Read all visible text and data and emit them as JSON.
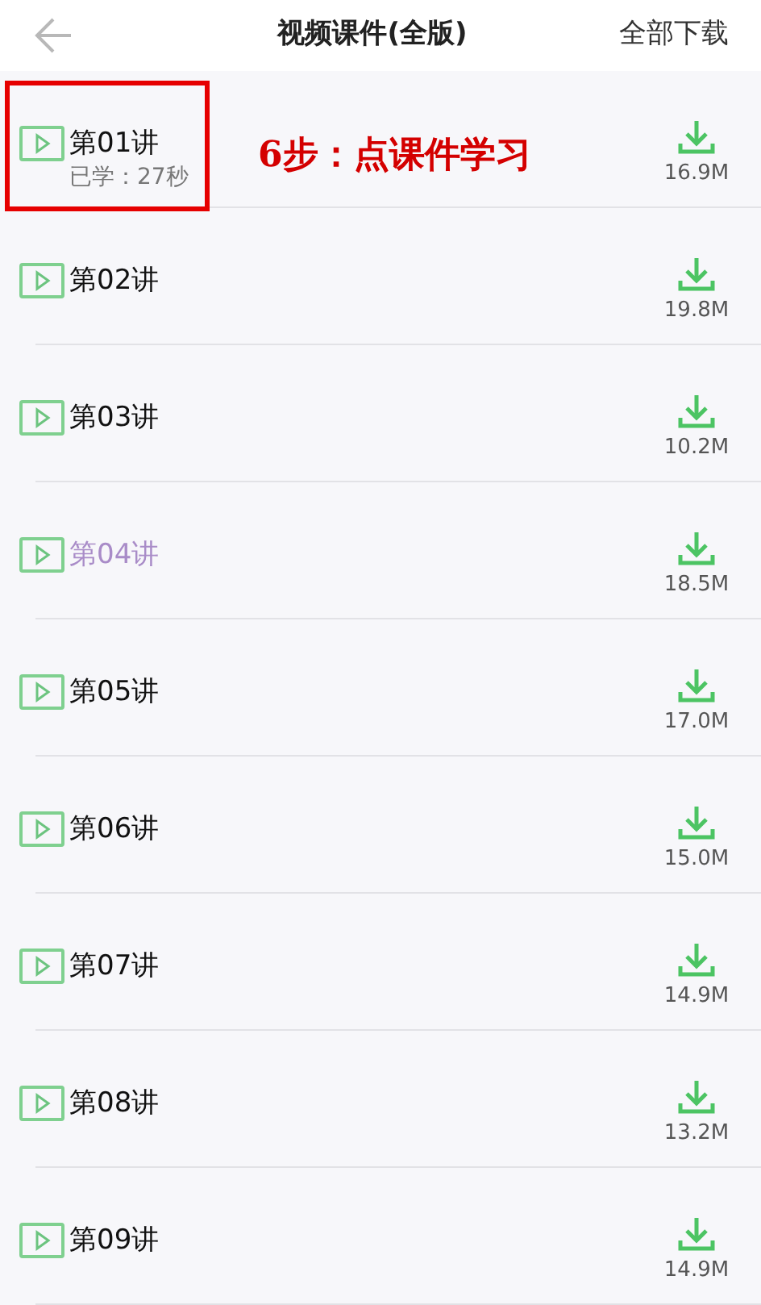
{
  "header": {
    "title": "视频课件(全版)",
    "action": "全部下载"
  },
  "annotation": {
    "text": "6步：点课件学习"
  },
  "lessons": [
    {
      "title": "第01讲",
      "progress": "已学：27秒",
      "size": "16.9M",
      "playing": false
    },
    {
      "title": "第02讲",
      "size": "19.8M",
      "playing": false
    },
    {
      "title": "第03讲",
      "size": "10.2M",
      "playing": false
    },
    {
      "title": "第04讲",
      "size": "18.5M",
      "playing": true
    },
    {
      "title": "第05讲",
      "size": "17.0M",
      "playing": false
    },
    {
      "title": "第06讲",
      "size": "15.0M",
      "playing": false
    },
    {
      "title": "第07讲",
      "size": "14.9M",
      "playing": false
    },
    {
      "title": "第08讲",
      "size": "13.2M",
      "playing": false
    },
    {
      "title": "第09讲",
      "size": "14.9M",
      "playing": false
    }
  ]
}
